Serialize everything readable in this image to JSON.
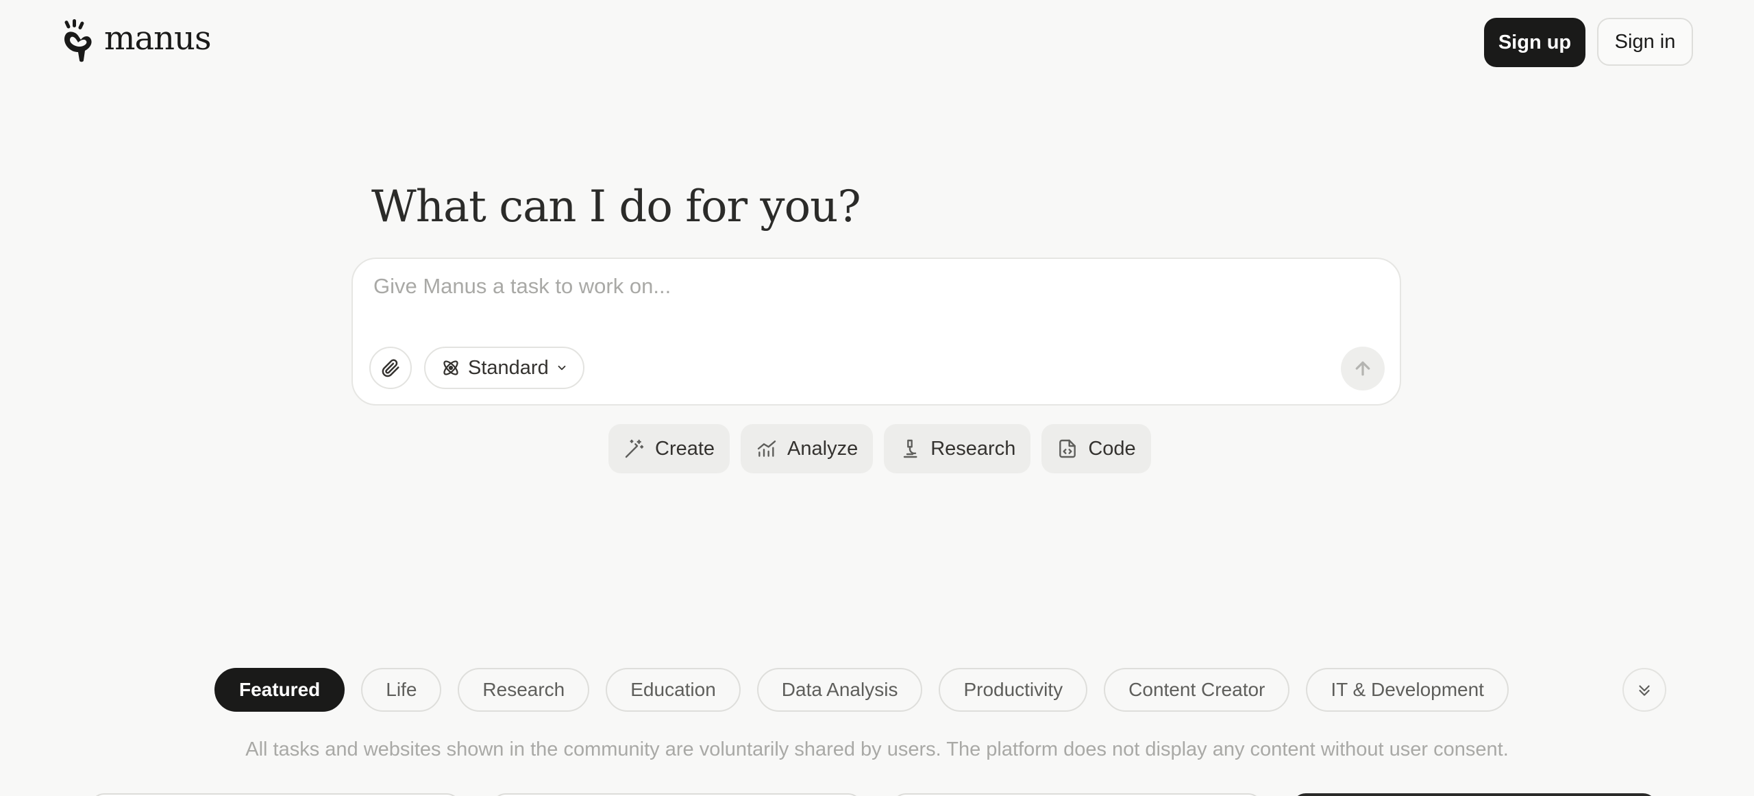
{
  "header": {
    "brand": "manus",
    "signup_label": "Sign up",
    "signin_label": "Sign in"
  },
  "hero": {
    "headline": "What can I do for you?"
  },
  "composer": {
    "placeholder": "Give Manus a task to work on...",
    "value": "",
    "mode_label": "Standard",
    "icons": {
      "attach": "paperclip-icon",
      "mode": "atom-icon",
      "mode_dropdown": "chevron-down-icon",
      "send": "arrow-up-icon"
    }
  },
  "quick_actions": [
    {
      "label": "Create",
      "icon": "magic-wand-icon"
    },
    {
      "label": "Analyze",
      "icon": "bar-chart-icon"
    },
    {
      "label": "Research",
      "icon": "microscope-icon"
    },
    {
      "label": "Code",
      "icon": "code-file-icon"
    }
  ],
  "categories": {
    "active": "Featured",
    "items": [
      "Featured",
      "Life",
      "Research",
      "Education",
      "Data Analysis",
      "Productivity",
      "Content Creator",
      "IT & Development"
    ]
  },
  "notice": "All tasks and websites shown in the community are voluntarily shared by users. The platform does not display any content without user consent.",
  "colors": {
    "background": "#f8f8f7",
    "primary": "#1a1a19",
    "chip_bg": "#ededeb",
    "muted_text": "#a9a9a6"
  }
}
